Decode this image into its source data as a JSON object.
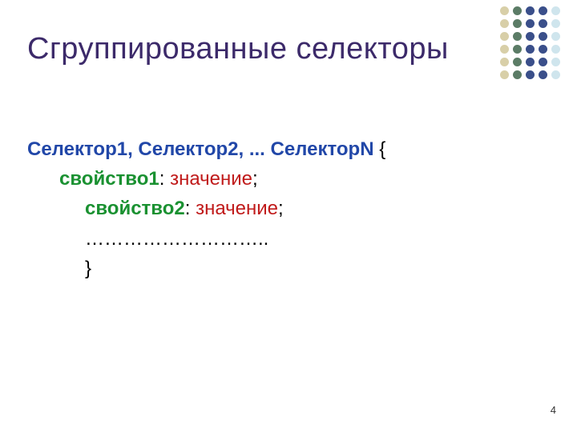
{
  "title": "Сгруппированные селекторы",
  "syntax": {
    "selectors": "Селектор1, Селектор2, ... СелекторN",
    "open_brace": " {",
    "prop1": "свойство1",
    "val1": "значение",
    "prop2": "свойство2",
    "val2": "значение",
    "sep_colon": ": ",
    "sep_semi": ";",
    "ellipsis_line": "………………………..",
    "close_brace": "}"
  },
  "pageNumber": "4"
}
